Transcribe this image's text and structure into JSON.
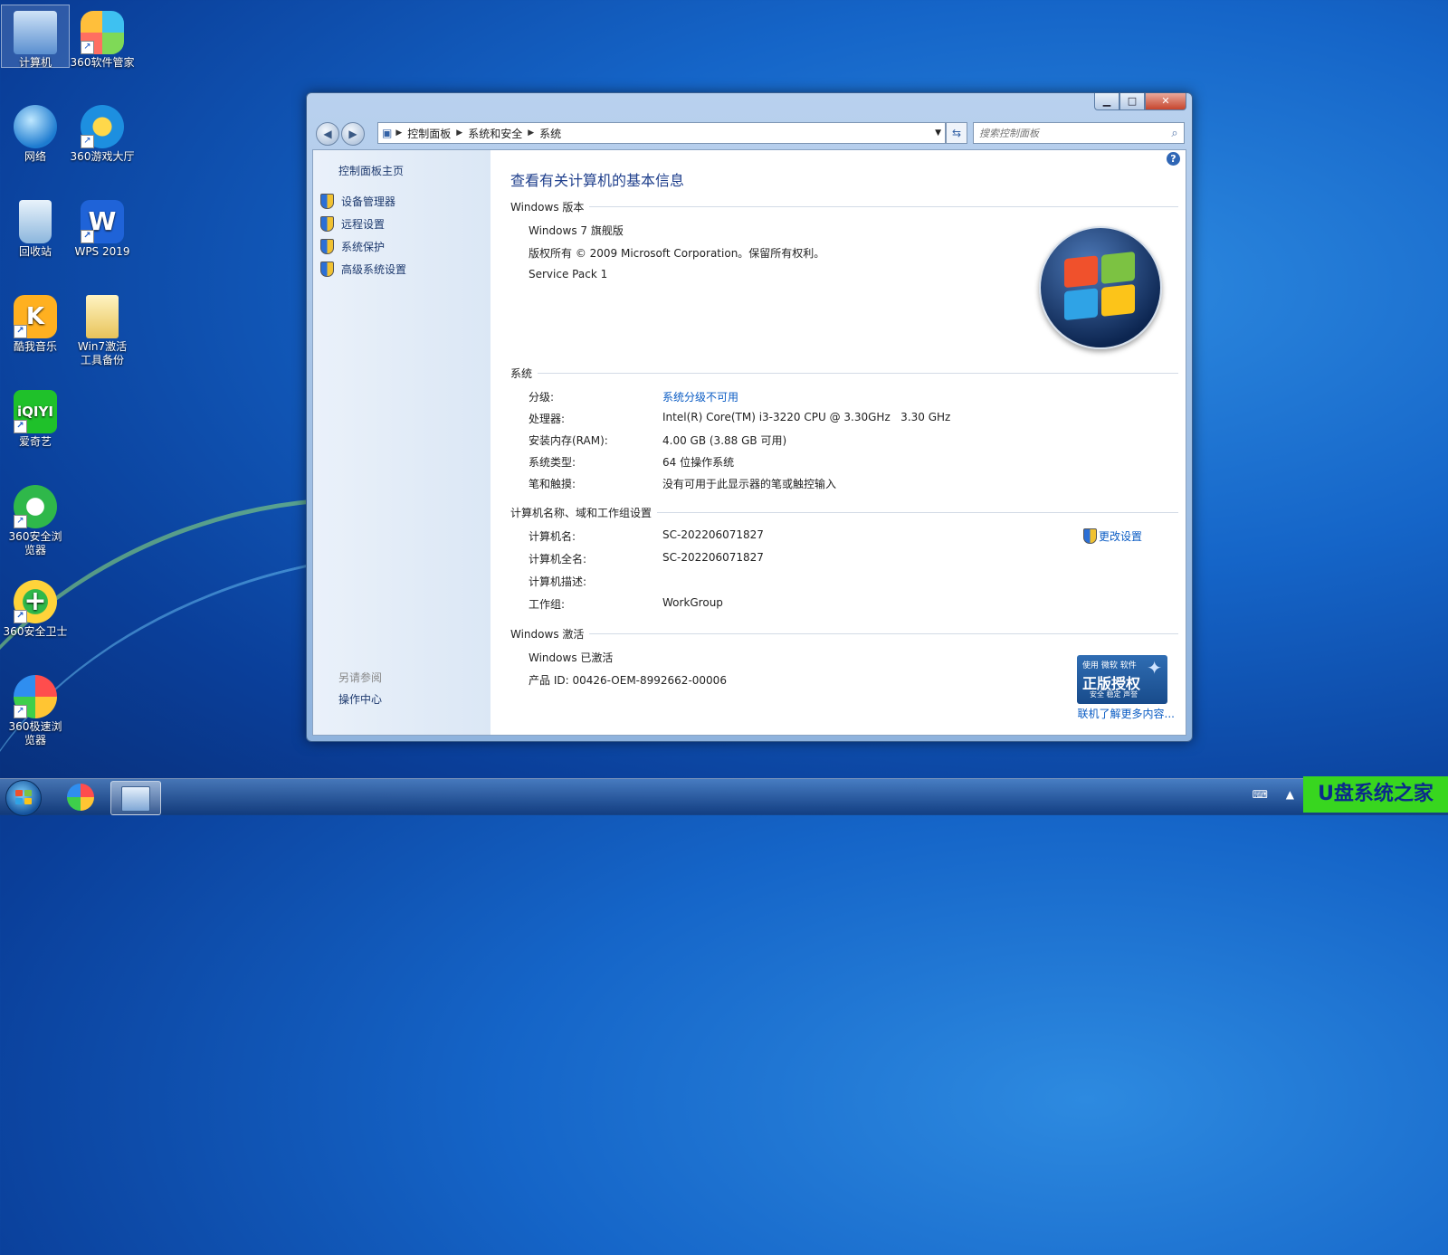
{
  "desktop": {
    "icons": [
      {
        "label": "计算机"
      },
      {
        "label": "360软件管家"
      },
      {
        "label": "网络"
      },
      {
        "label": "360游戏大厅"
      },
      {
        "label": "回收站"
      },
      {
        "label": "WPS 2019"
      },
      {
        "label": "酷我音乐"
      },
      {
        "label": "Win7激活工具备份"
      },
      {
        "label": "爱奇艺"
      },
      {
        "label": "360安全浏览器"
      },
      {
        "label": "360安全卫士"
      },
      {
        "label": "360极速浏览器"
      }
    ]
  },
  "window": {
    "address": {
      "crumbs": [
        "控制面板",
        "系统和安全",
        "系统"
      ]
    },
    "search": {
      "placeholder": "搜索控制面板"
    },
    "left": {
      "home": "控制面板主页",
      "tasks": [
        "设备管理器",
        "远程设置",
        "系统保护",
        "高级系统设置"
      ],
      "see_also": "另请参阅",
      "action_center": "操作中心"
    },
    "main": {
      "title": "查看有关计算机的基本信息",
      "edition": {
        "header": "Windows 版本",
        "name": "Windows 7 旗舰版",
        "copyright": "版权所有 © 2009 Microsoft Corporation。保留所有权利。",
        "sp": "Service Pack 1"
      },
      "system": {
        "header": "系统",
        "rows": [
          {
            "label": "分级:",
            "value": "系统分级不可用"
          },
          {
            "label": "处理器:",
            "value": "Intel(R) Core(TM) i3-3220 CPU @ 3.30GHz   3.30 GHz"
          },
          {
            "label": "安装内存(RAM):",
            "value": "4.00 GB (3.88 GB 可用)"
          },
          {
            "label": "系统类型:",
            "value": "64 位操作系统"
          },
          {
            "label": "笔和触摸:",
            "value": "没有可用于此显示器的笔或触控输入"
          }
        ]
      },
      "computer": {
        "header": "计算机名称、域和工作组设置",
        "change": "更改设置",
        "rows": [
          {
            "label": "计算机名:",
            "value": "SC-202206071827"
          },
          {
            "label": "计算机全名:",
            "value": "SC-202206071827"
          },
          {
            "label": "计算机描述:",
            "value": ""
          },
          {
            "label": "工作组:",
            "value": "WorkGroup"
          }
        ]
      },
      "activation": {
        "header": "Windows 激活",
        "status": "Windows 已激活",
        "product_id": "产品 ID: 00426-OEM-8992662-00006",
        "badge_small": "使用 微软 软件",
        "badge_big": "正版授权",
        "badge_sub": "安全 稳定 声誉",
        "more": "联机了解更多内容..."
      }
    }
  },
  "watermark": "U盘系统之家",
  "colors": {
    "accent": "#1f3f8c",
    "link": "#0b5cc4",
    "watermark_bg": "#38d61f"
  }
}
